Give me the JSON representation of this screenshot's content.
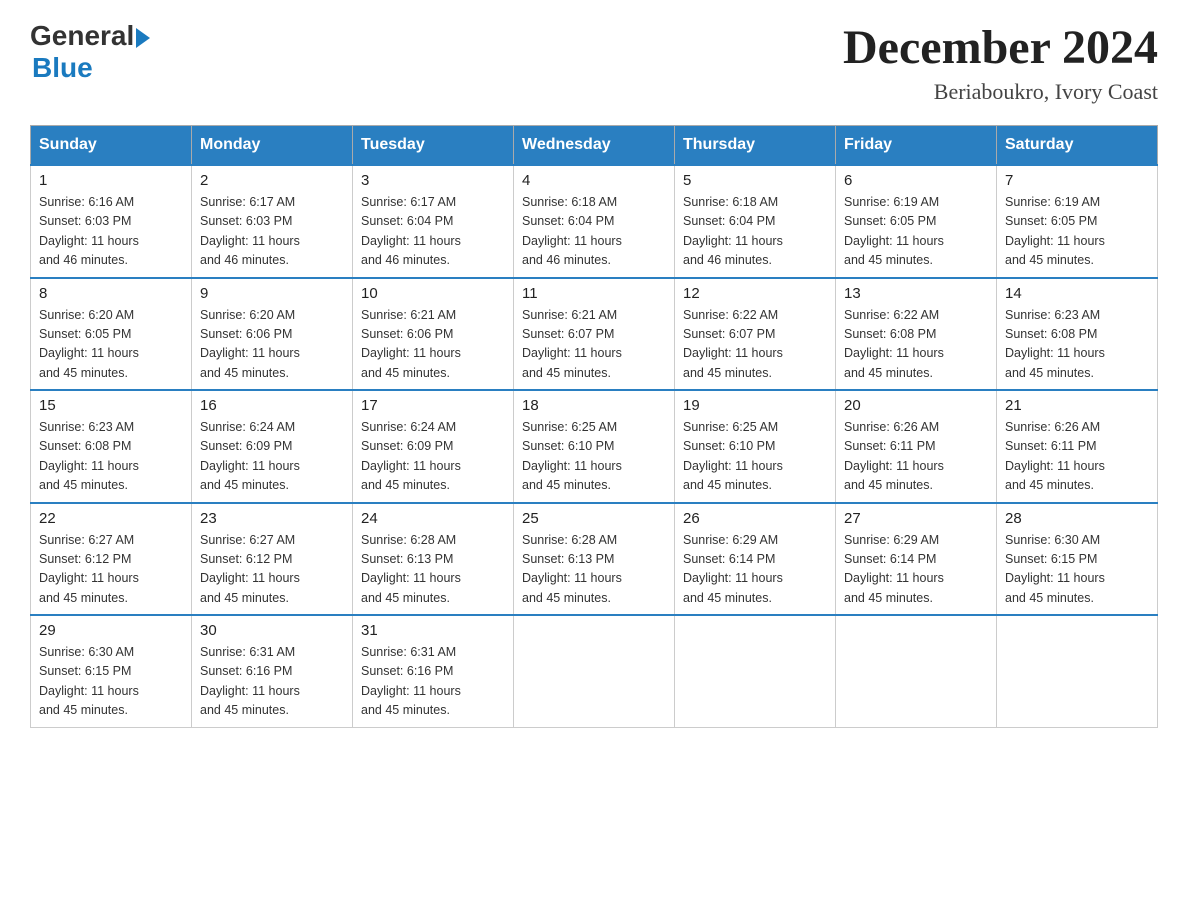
{
  "logo": {
    "general": "General",
    "blue": "Blue"
  },
  "title": {
    "month_year": "December 2024",
    "location": "Beriaboukro, Ivory Coast"
  },
  "headers": [
    "Sunday",
    "Monday",
    "Tuesday",
    "Wednesday",
    "Thursday",
    "Friday",
    "Saturday"
  ],
  "weeks": [
    [
      {
        "day": "1",
        "sunrise": "6:16 AM",
        "sunset": "6:03 PM",
        "daylight": "11 hours and 46 minutes."
      },
      {
        "day": "2",
        "sunrise": "6:17 AM",
        "sunset": "6:03 PM",
        "daylight": "11 hours and 46 minutes."
      },
      {
        "day": "3",
        "sunrise": "6:17 AM",
        "sunset": "6:04 PM",
        "daylight": "11 hours and 46 minutes."
      },
      {
        "day": "4",
        "sunrise": "6:18 AM",
        "sunset": "6:04 PM",
        "daylight": "11 hours and 46 minutes."
      },
      {
        "day": "5",
        "sunrise": "6:18 AM",
        "sunset": "6:04 PM",
        "daylight": "11 hours and 46 minutes."
      },
      {
        "day": "6",
        "sunrise": "6:19 AM",
        "sunset": "6:05 PM",
        "daylight": "11 hours and 45 minutes."
      },
      {
        "day": "7",
        "sunrise": "6:19 AM",
        "sunset": "6:05 PM",
        "daylight": "11 hours and 45 minutes."
      }
    ],
    [
      {
        "day": "8",
        "sunrise": "6:20 AM",
        "sunset": "6:05 PM",
        "daylight": "11 hours and 45 minutes."
      },
      {
        "day": "9",
        "sunrise": "6:20 AM",
        "sunset": "6:06 PM",
        "daylight": "11 hours and 45 minutes."
      },
      {
        "day": "10",
        "sunrise": "6:21 AM",
        "sunset": "6:06 PM",
        "daylight": "11 hours and 45 minutes."
      },
      {
        "day": "11",
        "sunrise": "6:21 AM",
        "sunset": "6:07 PM",
        "daylight": "11 hours and 45 minutes."
      },
      {
        "day": "12",
        "sunrise": "6:22 AM",
        "sunset": "6:07 PM",
        "daylight": "11 hours and 45 minutes."
      },
      {
        "day": "13",
        "sunrise": "6:22 AM",
        "sunset": "6:08 PM",
        "daylight": "11 hours and 45 minutes."
      },
      {
        "day": "14",
        "sunrise": "6:23 AM",
        "sunset": "6:08 PM",
        "daylight": "11 hours and 45 minutes."
      }
    ],
    [
      {
        "day": "15",
        "sunrise": "6:23 AM",
        "sunset": "6:08 PM",
        "daylight": "11 hours and 45 minutes."
      },
      {
        "day": "16",
        "sunrise": "6:24 AM",
        "sunset": "6:09 PM",
        "daylight": "11 hours and 45 minutes."
      },
      {
        "day": "17",
        "sunrise": "6:24 AM",
        "sunset": "6:09 PM",
        "daylight": "11 hours and 45 minutes."
      },
      {
        "day": "18",
        "sunrise": "6:25 AM",
        "sunset": "6:10 PM",
        "daylight": "11 hours and 45 minutes."
      },
      {
        "day": "19",
        "sunrise": "6:25 AM",
        "sunset": "6:10 PM",
        "daylight": "11 hours and 45 minutes."
      },
      {
        "day": "20",
        "sunrise": "6:26 AM",
        "sunset": "6:11 PM",
        "daylight": "11 hours and 45 minutes."
      },
      {
        "day": "21",
        "sunrise": "6:26 AM",
        "sunset": "6:11 PM",
        "daylight": "11 hours and 45 minutes."
      }
    ],
    [
      {
        "day": "22",
        "sunrise": "6:27 AM",
        "sunset": "6:12 PM",
        "daylight": "11 hours and 45 minutes."
      },
      {
        "day": "23",
        "sunrise": "6:27 AM",
        "sunset": "6:12 PM",
        "daylight": "11 hours and 45 minutes."
      },
      {
        "day": "24",
        "sunrise": "6:28 AM",
        "sunset": "6:13 PM",
        "daylight": "11 hours and 45 minutes."
      },
      {
        "day": "25",
        "sunrise": "6:28 AM",
        "sunset": "6:13 PM",
        "daylight": "11 hours and 45 minutes."
      },
      {
        "day": "26",
        "sunrise": "6:29 AM",
        "sunset": "6:14 PM",
        "daylight": "11 hours and 45 minutes."
      },
      {
        "day": "27",
        "sunrise": "6:29 AM",
        "sunset": "6:14 PM",
        "daylight": "11 hours and 45 minutes."
      },
      {
        "day": "28",
        "sunrise": "6:30 AM",
        "sunset": "6:15 PM",
        "daylight": "11 hours and 45 minutes."
      }
    ],
    [
      {
        "day": "29",
        "sunrise": "6:30 AM",
        "sunset": "6:15 PM",
        "daylight": "11 hours and 45 minutes."
      },
      {
        "day": "30",
        "sunrise": "6:31 AM",
        "sunset": "6:16 PM",
        "daylight": "11 hours and 45 minutes."
      },
      {
        "day": "31",
        "sunrise": "6:31 AM",
        "sunset": "6:16 PM",
        "daylight": "11 hours and 45 minutes."
      },
      null,
      null,
      null,
      null
    ]
  ],
  "labels": {
    "sunrise": "Sunrise:",
    "sunset": "Sunset:",
    "daylight": "Daylight:"
  }
}
